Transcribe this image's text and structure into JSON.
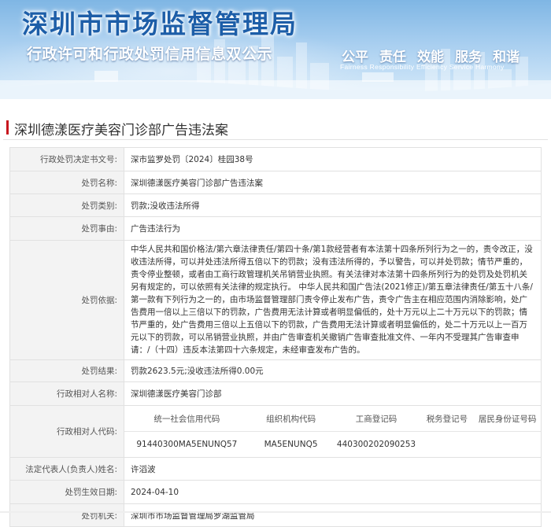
{
  "banner": {
    "title": "深圳市市场监督管理局",
    "subtitle": "行政许可和行政处罚信用信息双公示",
    "values": [
      "公平",
      "责任",
      "效能",
      "服务",
      "和谐"
    ],
    "values_en": "Fairness  Responsibility  Efficiency  Service  Harmony"
  },
  "page_title": "深圳德漾医疗美容门诊部广告违法案",
  "fields": {
    "decision_no": {
      "label": "行政处罚决定书文号:",
      "value": "深市监罗处罚〔2024〕桂园38号"
    },
    "case_name": {
      "label": "处罚名称:",
      "value": "深圳德漾医疗美容门诊部广告违法案"
    },
    "category": {
      "label": "处罚类别:",
      "value": "罚款;没收违法所得"
    },
    "reason": {
      "label": "处罚事由:",
      "value": "广告违法行为"
    },
    "basis": {
      "label": "处罚依据:",
      "value": "中华人民共和国价格法/第六章法律责任/第四十条/第1款经营者有本法第十四条所列行为之一的，责令改正，没收违法所得，可以并处违法所得五倍以下的罚款；没有违法所得的，予以警告，可以并处罚款；情节严重的，责令停业整顿，或者由工商行政管理机关吊销营业执照。有关法律对本法第十四条所列行为的处罚及处罚机关另有规定的，可以依照有关法律的规定执行。 中华人民共和国广告法(2021修正)/第五章法律责任/第五十八条/第一款有下列行为之一的，由市场监督管理部门责令停止发布广告，责令广告主在相应范围内消除影响，处广告费用一倍以上三倍以下的罚款，广告费用无法计算或者明显偏低的，处十万元以上二十万元以下的罚款；情节严重的，处广告费用三倍以上五倍以下的罚款，广告费用无法计算或者明显偏低的，处二十万元以上一百万元以下的罚款，可以吊销营业执照，并由广告审查机关撤销广告审查批准文件、一年内不受理其广告审查申请：/（十四）违反本法第四十六条规定，未经审查发布广告的。"
    },
    "result": {
      "label": "处罚结果:",
      "value": "罚款2623.5元;没收违法所得0.00元"
    },
    "party_name": {
      "label": "行政相对人名称:",
      "value": "深圳德漾医疗美容门诊部"
    },
    "party_codes": {
      "label": "行政相对人代码:",
      "headers": [
        "统一社会信用代码",
        "组织机构代码",
        "工商登记码",
        "税务登记号",
        "居民身份证号码"
      ],
      "values": [
        "91440300MA5ENUNQ57",
        "MA5ENUNQ5",
        "440300202090253",
        "",
        ""
      ]
    },
    "legal_rep": {
      "label": "法定代表人(负责人)姓名:",
      "value": "许滔波"
    },
    "date": {
      "label": "处罚生效日期:",
      "value": "2024-04-10"
    },
    "authority": {
      "label": "处罚机关:",
      "value": "深圳市市场监督管理局罗湖监管局"
    }
  }
}
